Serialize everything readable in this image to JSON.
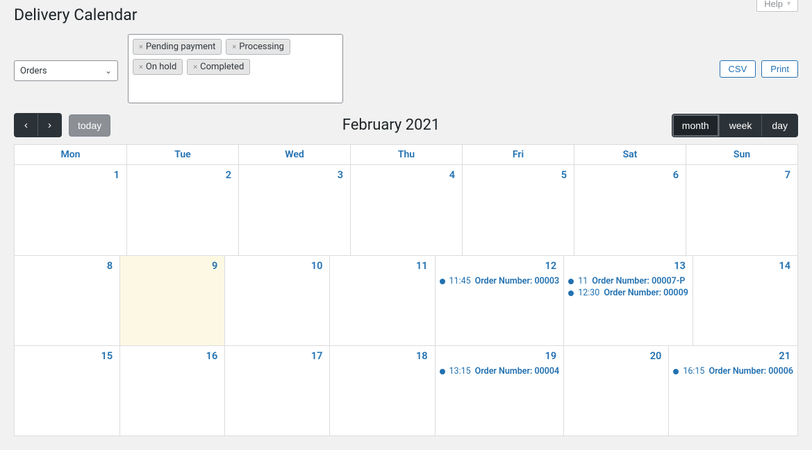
{
  "header": {
    "title": "Delivery Calendar",
    "help_label": "Help"
  },
  "filters": {
    "select_value": "Orders",
    "tags": [
      "Pending payment",
      "Processing",
      "On hold",
      "Completed"
    ]
  },
  "actions": {
    "csv": "CSV",
    "print": "Print"
  },
  "toolbar": {
    "today": "today",
    "title": "February 2021",
    "views": {
      "month": "month",
      "week": "week",
      "day": "day"
    },
    "active_view": "month"
  },
  "calendar": {
    "day_headers": [
      "Mon",
      "Tue",
      "Wed",
      "Thu",
      "Fri",
      "Sat",
      "Sun"
    ],
    "weeks": [
      {
        "days": [
          {
            "num": 1
          },
          {
            "num": 2
          },
          {
            "num": 3
          },
          {
            "num": 4
          },
          {
            "num": 5
          },
          {
            "num": 6
          },
          {
            "num": 7
          }
        ]
      },
      {
        "days": [
          {
            "num": 8
          },
          {
            "num": 9,
            "today": true
          },
          {
            "num": 10
          },
          {
            "num": 11
          },
          {
            "num": 12,
            "events": [
              {
                "time": "11:45",
                "title": "Order Number: 00003"
              }
            ]
          },
          {
            "num": 13,
            "events": [
              {
                "time": "11",
                "title": "Order Number: 00007-P"
              },
              {
                "time": "12:30",
                "title": "Order Number: 00009"
              }
            ]
          },
          {
            "num": 14
          }
        ]
      },
      {
        "days": [
          {
            "num": 15
          },
          {
            "num": 16
          },
          {
            "num": 17
          },
          {
            "num": 18
          },
          {
            "num": 19,
            "events": [
              {
                "time": "13:15",
                "title": "Order Number: 00004"
              }
            ]
          },
          {
            "num": 20
          },
          {
            "num": 21,
            "events": [
              {
                "time": "16:15",
                "title": "Order Number: 00006"
              }
            ]
          }
        ]
      }
    ]
  }
}
